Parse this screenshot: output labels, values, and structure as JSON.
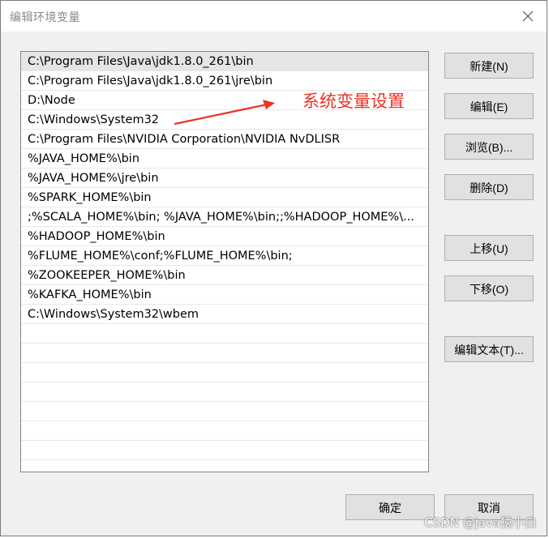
{
  "window": {
    "title": "编辑环境变量"
  },
  "path_list": {
    "items": [
      {
        "value": "C:\\Program Files\\Java\\jdk1.8.0_261\\bin",
        "selected": true
      },
      {
        "value": "C:\\Program Files\\Java\\jdk1.8.0_261\\jre\\bin",
        "selected": false
      },
      {
        "value": "D:\\Node",
        "selected": false
      },
      {
        "value": "C:\\Windows\\System32",
        "selected": false
      },
      {
        "value": "C:\\Program Files\\NVIDIA Corporation\\NVIDIA NvDLISR",
        "selected": false
      },
      {
        "value": "%JAVA_HOME%\\bin",
        "selected": false
      },
      {
        "value": "%JAVA_HOME%\\jre\\bin",
        "selected": false
      },
      {
        "value": "%SPARK_HOME%\\bin",
        "selected": false
      },
      {
        "value": ";%SCALA_HOME%\\bin; %JAVA_HOME%\\bin;;%HADOOP_HOME%\\...",
        "selected": false
      },
      {
        "value": "%HADOOP_HOME%\\bin",
        "selected": false
      },
      {
        "value": "%FLUME_HOME%\\conf;%FLUME_HOME%\\bin;",
        "selected": false
      },
      {
        "value": "%ZOOKEEPER_HOME%\\bin",
        "selected": false
      },
      {
        "value": "%KAFKA_HOME%\\bin",
        "selected": false
      },
      {
        "value": "C:\\Windows\\System32\\wbem",
        "selected": false
      }
    ]
  },
  "buttons": {
    "new": "新建(N)",
    "edit": "编辑(E)",
    "browse": "浏览(B)...",
    "delete": "删除(D)",
    "move_up": "上移(U)",
    "move_down": "下移(O)",
    "edit_text": "编辑文本(T)...",
    "ok": "确定",
    "cancel": "取消"
  },
  "annotation": {
    "text": "系统变量设置",
    "color": "#ea3323"
  },
  "watermark": {
    "text": "CSDN @java猿小白"
  },
  "icons": {
    "close": "close-icon",
    "arrow": "arrow-icon"
  }
}
